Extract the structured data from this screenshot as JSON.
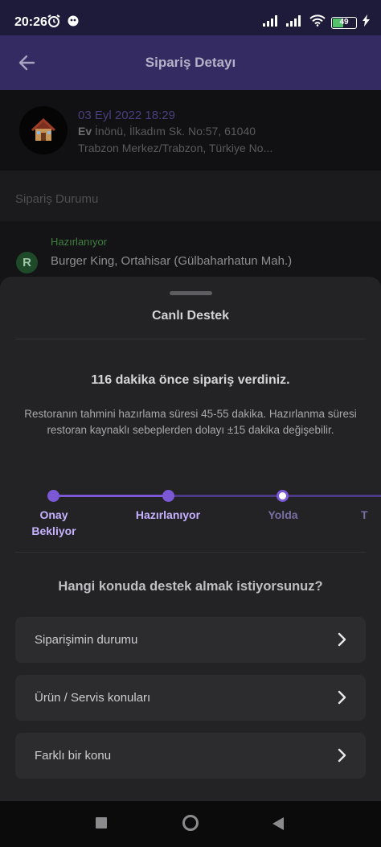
{
  "status_bar": {
    "time": "20:26",
    "battery": "49"
  },
  "header": {
    "title": "Sipariş Detayı"
  },
  "order": {
    "date": "03 Eyl 2022 18:29",
    "address_label": "Ev",
    "address_line1": "İnönü, İlkadım Sk. No:57, 61040",
    "address_line2": "Trabzon Merkez/Trabzon, Türkiye No..."
  },
  "order_status": {
    "section_title": "Sipariş Durumu",
    "status": "Hazırlanıyor",
    "restaurant_initial": "R",
    "restaurant": "Burger King, Ortahisar (Gülbaharhatun Mah.)"
  },
  "support_sheet": {
    "title": "Canlı Destek",
    "headline": "116 dakika önce sipariş verdiniz.",
    "info": "Restoranın tahmini hazırlama süresi 45-55 dakika. Hazırlanma süresi restoran kaynaklı sebeplerden dolayı ±15 dakika değişebilir.",
    "steps": [
      {
        "label": "Onay Bekliyor",
        "done": true
      },
      {
        "label": "Hazırlanıyor",
        "done": true
      },
      {
        "label": "Yolda",
        "done": false
      },
      {
        "label": "T",
        "done": false
      }
    ],
    "question": "Hangi konuda destek almak istiyorsunuz?",
    "options": [
      {
        "label": "Siparişimin durumu"
      },
      {
        "label": "Ürün / Servis konuları"
      },
      {
        "label": "Farklı bir konu"
      }
    ]
  },
  "colors": {
    "accent": "#7b58d6",
    "accent_light": "#c6b2ff",
    "header_bg": "#352b63",
    "sheet_bg": "#232325"
  }
}
